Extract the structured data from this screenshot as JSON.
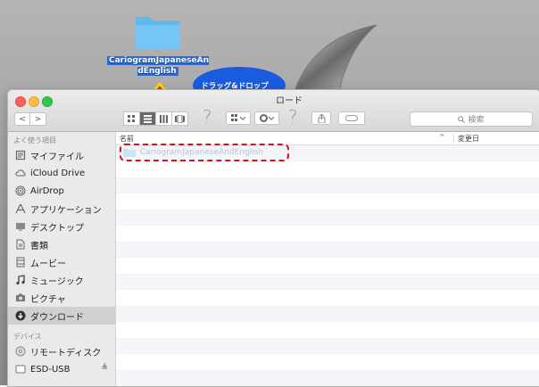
{
  "desktop": {
    "folder_label": "CariogramJapaneseAndEnglish",
    "callout_text": "ドラッグ&ドロップ"
  },
  "window": {
    "title": "ロード",
    "search_placeholder": "検索",
    "nav_back": "<",
    "nav_forward": ">"
  },
  "sidebar": {
    "favorites_header": "よく使う項目",
    "favorites": [
      {
        "label": "マイファイル",
        "icon": "all-files-icon"
      },
      {
        "label": "iCloud Drive",
        "icon": "cloud-icon"
      },
      {
        "label": "AirDrop",
        "icon": "airdrop-icon"
      },
      {
        "label": "アプリケーション",
        "icon": "applications-icon"
      },
      {
        "label": "デスクトップ",
        "icon": "desktop-icon"
      },
      {
        "label": "書類",
        "icon": "documents-icon"
      },
      {
        "label": "ムービー",
        "icon": "movies-icon"
      },
      {
        "label": "ミュージック",
        "icon": "music-icon"
      },
      {
        "label": "ピクチャ",
        "icon": "camera-icon"
      },
      {
        "label": "ダウンロード",
        "icon": "download-icon",
        "selected": true
      }
    ],
    "devices_header": "デバイス",
    "devices": [
      {
        "label": "リモートディスク",
        "icon": "remote-disc-icon"
      },
      {
        "label": "ESD-USB",
        "icon": "drive-icon",
        "eject": "≜"
      }
    ]
  },
  "content": {
    "col_name": "名前",
    "col_sort": "^",
    "col_date": "変更日",
    "dragged_file": "CariogramJapaneseAndEnglish"
  },
  "colors": {
    "highlight_dash": "#e0101a",
    "callout": "#1a5ce0",
    "arrow_fill": "#f03010",
    "arrow_edge": "#ffd400"
  }
}
